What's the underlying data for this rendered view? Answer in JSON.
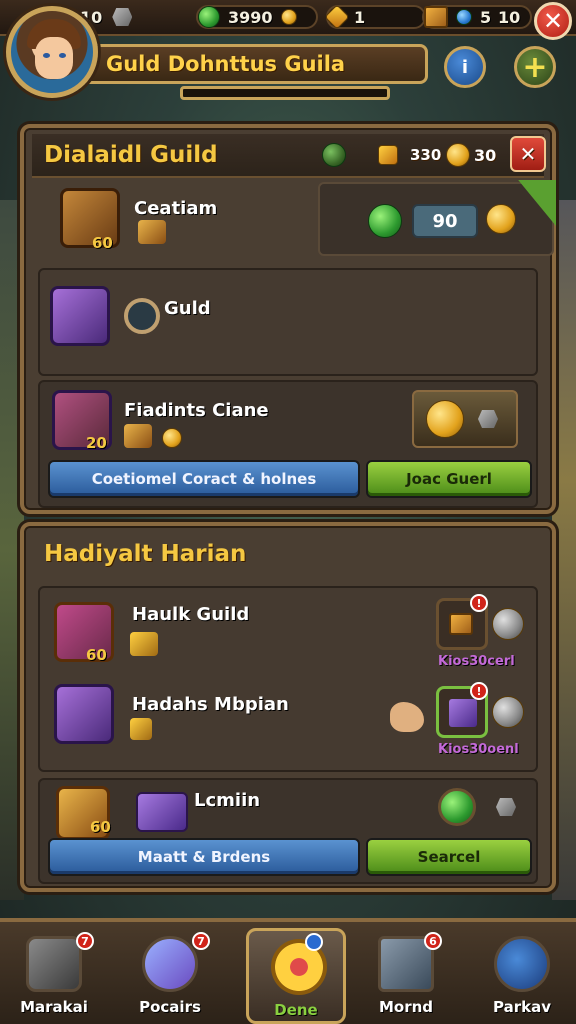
{
  "topbar": {
    "stone_count": "10",
    "gems": "3990",
    "keys": "1",
    "crates_value": "5",
    "energy": "10",
    "close_icon": "✕"
  },
  "profile": {
    "guild_name": "Guld Dohnttus Guila",
    "progress": 0.0,
    "info_icon": "i",
    "plus_icon": "+"
  },
  "panel1": {
    "title": "Dialaidl Guild",
    "header_value_a": "330",
    "header_value_b": "30",
    "close_icon": "✕",
    "rows": [
      {
        "title": "Ceatiam",
        "tag": "60",
        "reward_value": "90"
      },
      {
        "title": "Guld"
      },
      {
        "title": "Fiadints Ciane",
        "tag": "20"
      }
    ],
    "btn_left": "Coetiomel Coract & holnes",
    "btn_right": "Joac Guerl"
  },
  "panel2": {
    "title": "Hadiyalt Harian",
    "rows": [
      {
        "title": "Haulk Guild",
        "tag": "60",
        "sub": "Kios30cerl",
        "badge": "!"
      },
      {
        "title": "Hadahs Mbpian",
        "sub": "Kios30oenl",
        "badge": "!"
      },
      {
        "title": "Lcmiin",
        "tag": "60"
      }
    ],
    "btn_left": "Maatt & Brdens",
    "btn_right": "Searcel"
  },
  "nav": [
    {
      "label": "Marakai",
      "badge": "7"
    },
    {
      "label": "Pocairs",
      "badge": "7"
    },
    {
      "label": "Dene",
      "badge": ""
    },
    {
      "label": "Mornd",
      "badge": "6"
    },
    {
      "label": "Parkav",
      "badge": ""
    }
  ]
}
